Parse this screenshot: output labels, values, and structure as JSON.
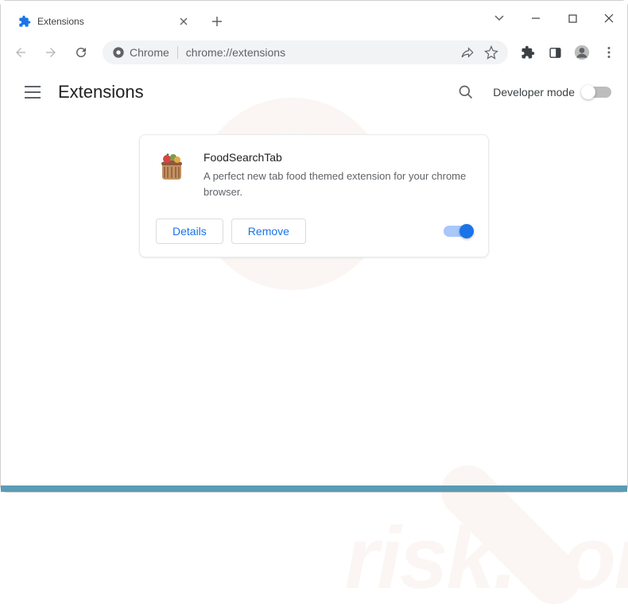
{
  "titlebar": {
    "tab_title": "Extensions"
  },
  "toolbar": {
    "omnibox_chip": "Chrome",
    "omnibox_url": "chrome://extensions"
  },
  "header": {
    "title": "Extensions",
    "dev_mode_label": "Developer mode"
  },
  "extension": {
    "name": "FoodSearchTab",
    "description": "A perfect new tab food themed extension for your chrome browser.",
    "details_label": "Details",
    "remove_label": "Remove",
    "enabled": true
  },
  "watermark": {
    "text": "risk.com"
  }
}
